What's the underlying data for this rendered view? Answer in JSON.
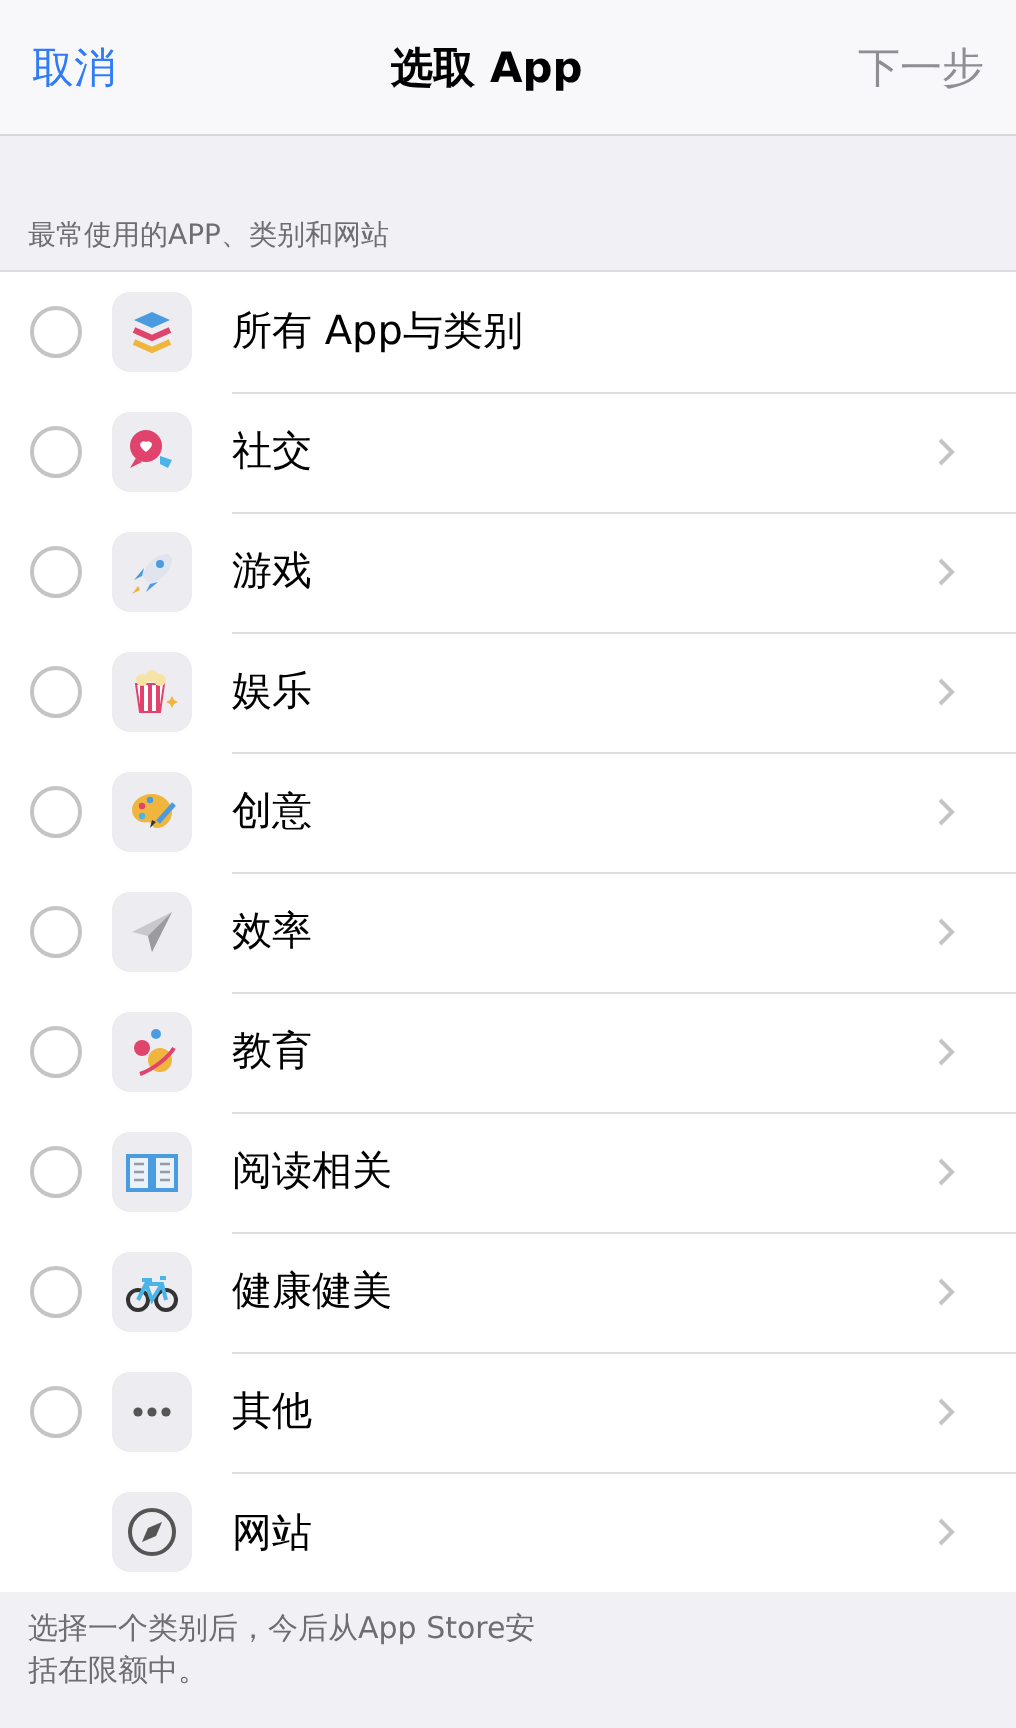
{
  "nav": {
    "cancel": "取消",
    "title": "选取 App",
    "next": "下一步",
    "next_disabled": true
  },
  "section_header": "最常使用的APP、类别和网站",
  "items": [
    {
      "kind": "all",
      "label": "所有 App与类别",
      "selected": false
    },
    {
      "kind": "category",
      "label": "社交",
      "selected": false
    },
    {
      "kind": "category",
      "label": "游戏",
      "selected": false
    },
    {
      "kind": "category",
      "label": "娱乐",
      "selected": false
    },
    {
      "kind": "category",
      "label": "创意",
      "selected": false
    },
    {
      "kind": "category",
      "label": "效率",
      "selected": false
    },
    {
      "kind": "category",
      "label": "教育",
      "selected": false
    },
    {
      "kind": "category",
      "label": "阅读相关",
      "selected": false
    },
    {
      "kind": "category",
      "label": "健康健美",
      "selected": false
    },
    {
      "kind": "category",
      "label": "其他",
      "selected": false
    },
    {
      "kind": "website",
      "label": "网站"
    }
  ],
  "footer_lines": [
    "选择一个类别后，今后从App Store安",
    "括在限额中。"
  ]
}
